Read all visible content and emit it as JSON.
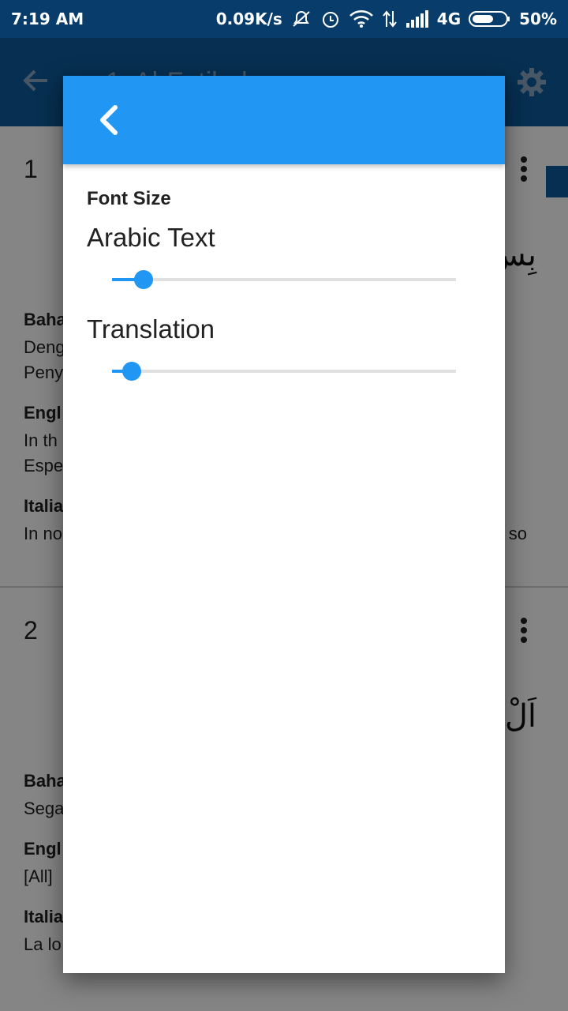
{
  "status_bar": {
    "time": "7:19 AM",
    "speed": "0.09K/s",
    "network": "4G",
    "battery": "50%"
  },
  "app_bar": {
    "title": "1. Al-Fatihah",
    "back_icon": "arrow-left-icon",
    "settings_icon": "gear-icon"
  },
  "verses": [
    {
      "number": "1",
      "arabic": "بِسْ",
      "label_1": "Baha",
      "text_1a": "Deng",
      "text_1b": "Peny",
      "label_2": "Engl",
      "text_2a": "In th",
      "text_2b": "Espe",
      "label_3": "Italia",
      "text_3a": "In no",
      "text_3_tail": "so"
    },
    {
      "number": "2",
      "arabic": "اَلْ",
      "label_1": "Baha",
      "text_1a": "Sega",
      "label_2": "Engl",
      "text_2a": "[All]",
      "label_3": "Italia",
      "text_3a": "La lo"
    }
  ],
  "dialog": {
    "back_icon": "chevron-left-icon",
    "section_title": "Font Size",
    "sliders": [
      {
        "label": "Arabic Text",
        "value_fraction": 0.065
      },
      {
        "label": "Translation",
        "value_fraction": 0.03
      }
    ]
  },
  "colors": {
    "status_bar": "#083d6b",
    "app_bar": "#0e5a9c",
    "dialog_header": "#2196f3",
    "accent": "#2196f3"
  }
}
